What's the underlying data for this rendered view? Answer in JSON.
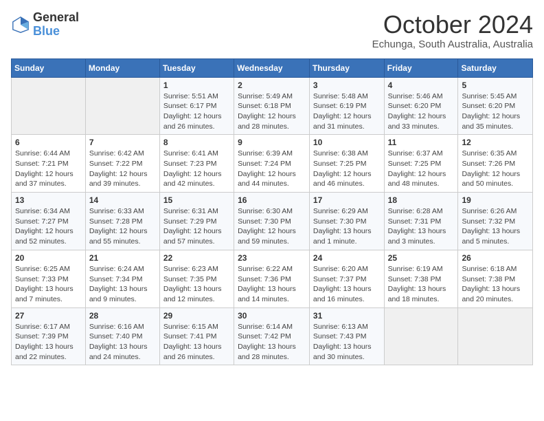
{
  "logo": {
    "text_general": "General",
    "text_blue": "Blue"
  },
  "title": "October 2024",
  "subtitle": "Echunga, South Australia, Australia",
  "days_of_week": [
    "Sunday",
    "Monday",
    "Tuesday",
    "Wednesday",
    "Thursday",
    "Friday",
    "Saturday"
  ],
  "weeks": [
    [
      {
        "day": "",
        "info": ""
      },
      {
        "day": "",
        "info": ""
      },
      {
        "day": "1",
        "info": "Sunrise: 5:51 AM\nSunset: 6:17 PM\nDaylight: 12 hours\nand 26 minutes."
      },
      {
        "day": "2",
        "info": "Sunrise: 5:49 AM\nSunset: 6:18 PM\nDaylight: 12 hours\nand 28 minutes."
      },
      {
        "day": "3",
        "info": "Sunrise: 5:48 AM\nSunset: 6:19 PM\nDaylight: 12 hours\nand 31 minutes."
      },
      {
        "day": "4",
        "info": "Sunrise: 5:46 AM\nSunset: 6:20 PM\nDaylight: 12 hours\nand 33 minutes."
      },
      {
        "day": "5",
        "info": "Sunrise: 5:45 AM\nSunset: 6:20 PM\nDaylight: 12 hours\nand 35 minutes."
      }
    ],
    [
      {
        "day": "6",
        "info": "Sunrise: 6:44 AM\nSunset: 7:21 PM\nDaylight: 12 hours\nand 37 minutes."
      },
      {
        "day": "7",
        "info": "Sunrise: 6:42 AM\nSunset: 7:22 PM\nDaylight: 12 hours\nand 39 minutes."
      },
      {
        "day": "8",
        "info": "Sunrise: 6:41 AM\nSunset: 7:23 PM\nDaylight: 12 hours\nand 42 minutes."
      },
      {
        "day": "9",
        "info": "Sunrise: 6:39 AM\nSunset: 7:24 PM\nDaylight: 12 hours\nand 44 minutes."
      },
      {
        "day": "10",
        "info": "Sunrise: 6:38 AM\nSunset: 7:25 PM\nDaylight: 12 hours\nand 46 minutes."
      },
      {
        "day": "11",
        "info": "Sunrise: 6:37 AM\nSunset: 7:25 PM\nDaylight: 12 hours\nand 48 minutes."
      },
      {
        "day": "12",
        "info": "Sunrise: 6:35 AM\nSunset: 7:26 PM\nDaylight: 12 hours\nand 50 minutes."
      }
    ],
    [
      {
        "day": "13",
        "info": "Sunrise: 6:34 AM\nSunset: 7:27 PM\nDaylight: 12 hours\nand 52 minutes."
      },
      {
        "day": "14",
        "info": "Sunrise: 6:33 AM\nSunset: 7:28 PM\nDaylight: 12 hours\nand 55 minutes."
      },
      {
        "day": "15",
        "info": "Sunrise: 6:31 AM\nSunset: 7:29 PM\nDaylight: 12 hours\nand 57 minutes."
      },
      {
        "day": "16",
        "info": "Sunrise: 6:30 AM\nSunset: 7:30 PM\nDaylight: 12 hours\nand 59 minutes."
      },
      {
        "day": "17",
        "info": "Sunrise: 6:29 AM\nSunset: 7:30 PM\nDaylight: 13 hours\nand 1 minute."
      },
      {
        "day": "18",
        "info": "Sunrise: 6:28 AM\nSunset: 7:31 PM\nDaylight: 13 hours\nand 3 minutes."
      },
      {
        "day": "19",
        "info": "Sunrise: 6:26 AM\nSunset: 7:32 PM\nDaylight: 13 hours\nand 5 minutes."
      }
    ],
    [
      {
        "day": "20",
        "info": "Sunrise: 6:25 AM\nSunset: 7:33 PM\nDaylight: 13 hours\nand 7 minutes."
      },
      {
        "day": "21",
        "info": "Sunrise: 6:24 AM\nSunset: 7:34 PM\nDaylight: 13 hours\nand 9 minutes."
      },
      {
        "day": "22",
        "info": "Sunrise: 6:23 AM\nSunset: 7:35 PM\nDaylight: 13 hours\nand 12 minutes."
      },
      {
        "day": "23",
        "info": "Sunrise: 6:22 AM\nSunset: 7:36 PM\nDaylight: 13 hours\nand 14 minutes."
      },
      {
        "day": "24",
        "info": "Sunrise: 6:20 AM\nSunset: 7:37 PM\nDaylight: 13 hours\nand 16 minutes."
      },
      {
        "day": "25",
        "info": "Sunrise: 6:19 AM\nSunset: 7:38 PM\nDaylight: 13 hours\nand 18 minutes."
      },
      {
        "day": "26",
        "info": "Sunrise: 6:18 AM\nSunset: 7:38 PM\nDaylight: 13 hours\nand 20 minutes."
      }
    ],
    [
      {
        "day": "27",
        "info": "Sunrise: 6:17 AM\nSunset: 7:39 PM\nDaylight: 13 hours\nand 22 minutes."
      },
      {
        "day": "28",
        "info": "Sunrise: 6:16 AM\nSunset: 7:40 PM\nDaylight: 13 hours\nand 24 minutes."
      },
      {
        "day": "29",
        "info": "Sunrise: 6:15 AM\nSunset: 7:41 PM\nDaylight: 13 hours\nand 26 minutes."
      },
      {
        "day": "30",
        "info": "Sunrise: 6:14 AM\nSunset: 7:42 PM\nDaylight: 13 hours\nand 28 minutes."
      },
      {
        "day": "31",
        "info": "Sunrise: 6:13 AM\nSunset: 7:43 PM\nDaylight: 13 hours\nand 30 minutes."
      },
      {
        "day": "",
        "info": ""
      },
      {
        "day": "",
        "info": ""
      }
    ]
  ]
}
